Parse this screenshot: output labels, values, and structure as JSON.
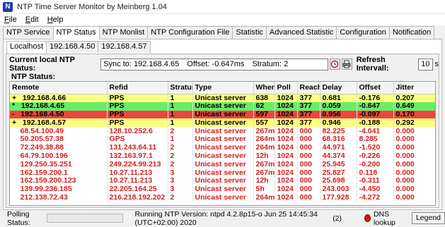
{
  "window": {
    "title": "NTP Time Server Monitor by Meinberg 1.04",
    "icon": "meinberg-app-icon"
  },
  "menu": [
    {
      "pre": "",
      "key": "F",
      "post": "ile"
    },
    {
      "pre": "",
      "key": "E",
      "post": "dit"
    },
    {
      "pre": "",
      "key": "H",
      "post": "elp"
    }
  ],
  "tabs": [
    "NTP Service",
    "NTP Status",
    "NTP Monlist",
    "NTP Configuration File",
    "Statistic",
    "Advanced Statistic",
    "Configuration",
    "Notification"
  ],
  "active_tab": "NTP Status",
  "subtabs": [
    "Localhost",
    "192.168.4.50",
    "192.168.4.57"
  ],
  "active_subtab": "Localhost",
  "status": {
    "label": "Current local NTP Status:",
    "sync": "Sync to: 192.168.4.65",
    "offset": "Offset: -0.647ms",
    "stratum": "Stratum: 2",
    "refresh_label": "Refresh Intervall:",
    "refresh_value": "10",
    "refresh_unit": "s"
  },
  "group_label": "NTP Status:",
  "table": {
    "columns": [
      "Remote",
      "Refid",
      "Stratum",
      "Type",
      "When",
      "Poll",
      "Reach",
      "Delay",
      "Offset",
      "Jitter"
    ],
    "rows": [
      {
        "color": "yellow",
        "cells": [
          "+   192.168.4.66",
          "PPS",
          "1",
          "Unicast server",
          "638",
          "1024",
          "377",
          "0.681",
          "-0.176",
          "0.207"
        ]
      },
      {
        "color": "green",
        "cells": [
          "*   192.168.4.65",
          "PPS",
          "1",
          "Unicast server",
          "62",
          "1024",
          "377",
          "0.059",
          "-0.647",
          "0.649"
        ]
      },
      {
        "color": "red",
        "cells": [
          "-   192.168.4.50",
          "PPS",
          "1",
          "Unicast server",
          "597",
          "1024",
          "377",
          "0.956",
          "-0.097",
          "0.170"
        ]
      },
      {
        "color": "yellow",
        "cells": [
          "+   192.168.4.57",
          "PPS",
          "1",
          "Unicast server",
          "557",
          "1024",
          "377",
          "0.946",
          "-0.188",
          "0.292"
        ]
      },
      {
        "color": "plain",
        "cells": [
          "    68.54.100.49",
          "128.10.252.6",
          "2",
          "Unicast server",
          "267m",
          "1024",
          "000",
          "82.225",
          "-4.041",
          "0.000"
        ]
      },
      {
        "color": "plain",
        "cells": [
          "    50.205.57.38",
          "GPS",
          "1",
          "Unicast server",
          "264m",
          "1024",
          "000",
          "68.316",
          "8.285",
          "0.000"
        ]
      },
      {
        "color": "plain",
        "cells": [
          "    72.249.38.88",
          "131.243.64.11",
          "2",
          "Unicast server",
          "264m",
          "1024",
          "000",
          "44.971",
          "-1.520",
          "0.000"
        ]
      },
      {
        "color": "plain",
        "cells": [
          "    64.79.100.196",
          "132.163.97.1",
          "2",
          "Unicast server",
          "12h",
          "1024",
          "000",
          "44.374",
          "-0.226",
          "0.000"
        ]
      },
      {
        "color": "plain",
        "cells": [
          "    129.250.35.251",
          "249.224.99.213",
          "2",
          "Unicast server",
          "267m",
          "1024",
          "000",
          "25.945",
          "-0.200",
          "0.000"
        ]
      },
      {
        "color": "plain",
        "cells": [
          "    162.159.200.1",
          "10.27.11.213",
          "3",
          "Unicast server",
          "267m",
          "1024",
          "000",
          "25.827",
          "0.118",
          "0.000"
        ]
      },
      {
        "color": "plain",
        "cells": [
          "    162.159.200.123",
          "10.27.11.213",
          "3",
          "Unicast server",
          "12h",
          "1024",
          "000",
          "25.698",
          "-0.311",
          "0.000"
        ]
      },
      {
        "color": "plain",
        "cells": [
          "    139.99.236.185",
          "22.205.164.25",
          "3",
          "Unicast server",
          "5h",
          "1024",
          "000",
          "243.003",
          "-4.450",
          "0.000"
        ]
      },
      {
        "color": "plain",
        "cells": [
          "    212.138.72.43",
          "216.218.192.202",
          "2",
          "Unicast server",
          "264m",
          "1024",
          "000",
          "177.928",
          "-4.272",
          "0.000"
        ]
      }
    ]
  },
  "statusbar": {
    "polling_label": "Polling Status:",
    "version": "Running NTP Version: ntpd 4.2.8p15-o Jun 25 14:45:34 (UTC+02:00) 2020",
    "count": "(2)",
    "dns": "DNS lookup",
    "legend": "Legend"
  },
  "colors": {
    "yellow": "#ffff80",
    "green": "#66ee66",
    "red": "#ee4444",
    "plain_text": "#d22020"
  }
}
